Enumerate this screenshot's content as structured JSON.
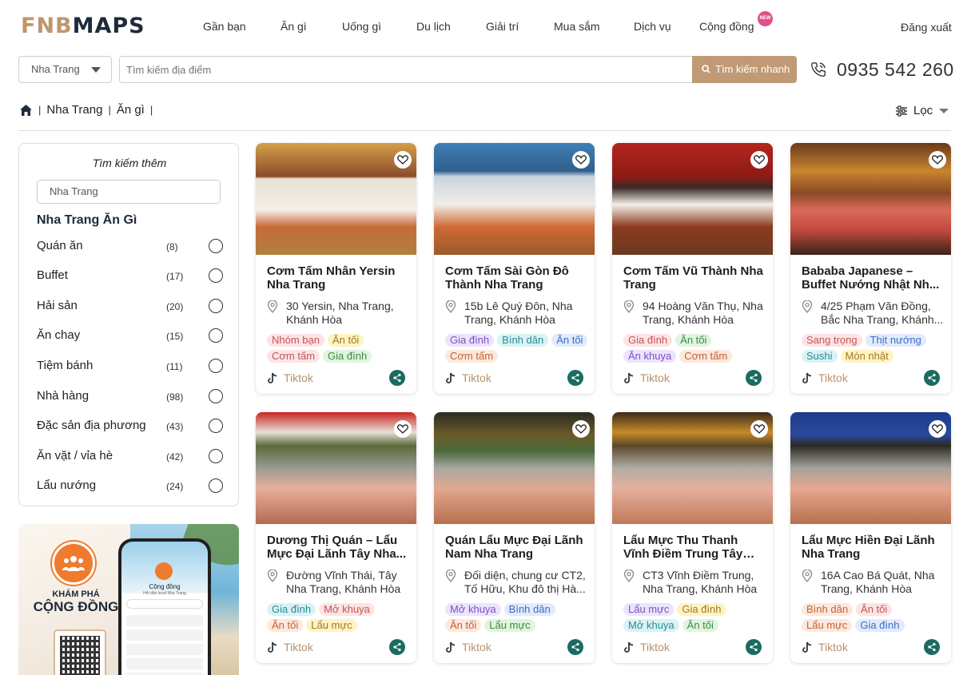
{
  "header": {
    "logo_a": "FNB",
    "logo_b": "MAPS",
    "nav": [
      "Gần bạn",
      "Ăn gì",
      "Uống gì",
      "Du lịch",
      "Giải trí",
      "Mua sắm",
      "Dịch vụ",
      "Cộng đồng"
    ],
    "new_badge": "NEW",
    "logout": "Đăng xuất"
  },
  "search": {
    "city": "Nha Trang",
    "placeholder": "Tìm kiếm địa điểm",
    "button": "Tìm kiếm nhanh",
    "phone": "0935 542 260"
  },
  "breadcrumb": {
    "items": [
      "Nha Trang",
      "Ăn gì"
    ],
    "sep": "|"
  },
  "filter": {
    "label": "Lọc"
  },
  "sidebar": {
    "title": "Tìm kiếm thêm",
    "input_value": "Nha Trang",
    "heading": "Nha Trang Ăn Gì",
    "categories": [
      {
        "label": "Quán ăn",
        "count": "(8)"
      },
      {
        "label": "Buffet",
        "count": "(17)"
      },
      {
        "label": "Hải sản",
        "count": "(20)"
      },
      {
        "label": "Ăn chay",
        "count": "(15)"
      },
      {
        "label": "Tiệm bánh",
        "count": "(11)"
      },
      {
        "label": "Nhà hàng",
        "count": "(98)"
      },
      {
        "label": "Đặc sản địa phương",
        "count": "(43)"
      },
      {
        "label": "Ăn vặt / vỉa hè",
        "count": "(42)"
      },
      {
        "label": "Lẩu nướng",
        "count": "(24)"
      }
    ]
  },
  "promo": {
    "line1": "KHÁM PHÁ",
    "line2": "CỘNG ĐỒNG",
    "phone_title": "Cộng đồng",
    "phone_sub": "Hỏi dân local Nha Trang"
  },
  "cards": [
    {
      "name": "Cơm Tấm Nhân Yersin Nha Trang",
      "address": "30 Yersin, Nha Trang, Khánh Hòa",
      "source": "Tiktok",
      "tags": [
        {
          "label": "Nhóm bạn",
          "color": "pink"
        },
        {
          "label": "Ăn tối",
          "color": "yel"
        },
        {
          "label": "Cơm tấm",
          "color": "pink"
        },
        {
          "label": "Gia đình",
          "color": "grn"
        }
      ]
    },
    {
      "name": "Cơm Tấm Sài Gòn Đô Thành Nha Trang",
      "address": "15b Lê Quý Đôn, Nha Trang, Khánh Hòa",
      "source": "Tiktok",
      "tags": [
        {
          "label": "Gia đình",
          "color": "pur"
        },
        {
          "label": "Bình dân",
          "color": "cyn"
        },
        {
          "label": "Ăn tối",
          "color": "blu"
        },
        {
          "label": "Cơm tấm",
          "color": "org"
        }
      ]
    },
    {
      "name": "Cơm Tấm Vũ Thành Nha Trang",
      "address": "94 Hoàng Văn Thụ, Nha Trang, Khánh Hòa",
      "source": "Tiktok",
      "tags": [
        {
          "label": "Gia đình",
          "color": "pink"
        },
        {
          "label": "Ăn tối",
          "color": "grn"
        },
        {
          "label": "Ăn khuya",
          "color": "pur"
        },
        {
          "label": "Cơm tấm",
          "color": "org"
        }
      ]
    },
    {
      "name": "Bababa Japanese – Buffet Nướng Nhật Nh...",
      "address": "4/25 Phạm Văn Đồng, Bắc Nha Trang, Khánh...",
      "source": "Tiktok",
      "tags": [
        {
          "label": "Sang trọng",
          "color": "pink"
        },
        {
          "label": "Thịt nướng",
          "color": "blu"
        },
        {
          "label": "Sushi",
          "color": "cyn"
        },
        {
          "label": "Món nhật",
          "color": "yel"
        }
      ]
    },
    {
      "name": "Dương Thị Quán – Lẩu Mực Đại Lãnh Tây Nha...",
      "address": "Đường Vĩnh Thái, Tây Nha Trang, Khánh Hòa",
      "source": "Tiktok",
      "tags": [
        {
          "label": "Gia đình",
          "color": "cyn"
        },
        {
          "label": "Mở khuya",
          "color": "pink"
        },
        {
          "label": "Ăn tối",
          "color": "org"
        },
        {
          "label": "Lẩu mực",
          "color": "yel"
        }
      ]
    },
    {
      "name": "Quán Lẩu Mực Đại Lãnh Nam Nha Trang",
      "address": "Đối diện, chung cư CT2, Tố Hữu, Khu đô thị Hà...",
      "source": "Tiktok",
      "tags": [
        {
          "label": "Mở khuya",
          "color": "pur"
        },
        {
          "label": "Bình dân",
          "color": "blu"
        },
        {
          "label": "Ăn tối",
          "color": "org"
        },
        {
          "label": "Lẩu mực",
          "color": "grn"
        }
      ]
    },
    {
      "name": "Lẩu Mực Thu Thanh Vĩnh Điềm Trung Tây Nha...",
      "address": "CT3 Vĩnh Điềm Trung, Nha Trang, Khánh Hòa",
      "source": "Tiktok",
      "tags": [
        {
          "label": "Lẩu mực",
          "color": "pur"
        },
        {
          "label": "Gia đình",
          "color": "yel"
        },
        {
          "label": "Mở khuya",
          "color": "cyn"
        },
        {
          "label": "Ăn tối",
          "color": "grn"
        }
      ]
    },
    {
      "name": "Lẩu Mực Hiền Đại Lãnh Nha Trang",
      "address": "16A Cao Bá Quát, Nha Trang, Khánh Hòa",
      "source": "Tiktok",
      "tags": [
        {
          "label": "Bình dân",
          "color": "org"
        },
        {
          "label": "Ăn tối",
          "color": "pink"
        },
        {
          "label": "Lẩu mực",
          "color": "org"
        },
        {
          "label": "Gia đình",
          "color": "blu"
        }
      ]
    }
  ],
  "colors": {
    "accent": "#bf9a74",
    "brand_dark": "#1f2b3a",
    "share": "#1b6b62"
  }
}
